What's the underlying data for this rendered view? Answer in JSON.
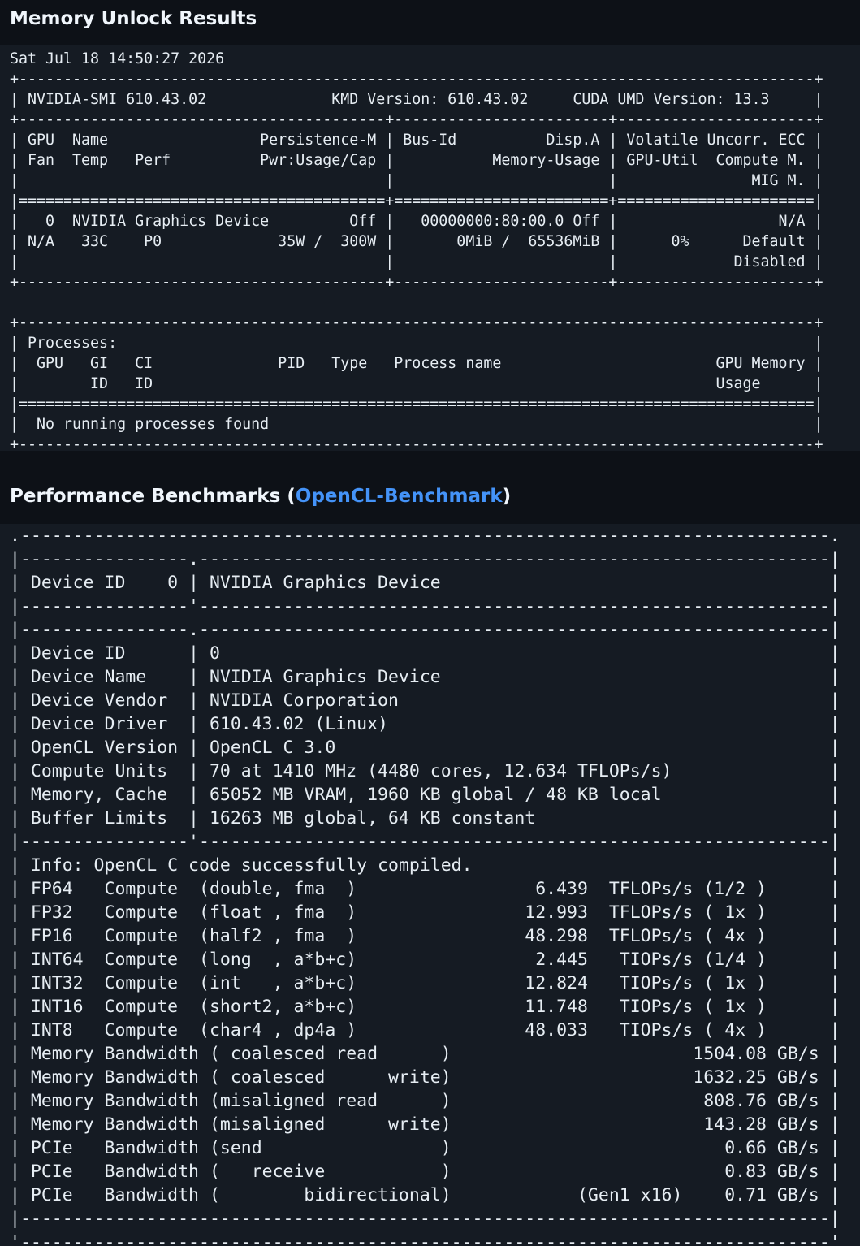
{
  "section_memory": {
    "title": "Memory Unlock Results"
  },
  "nvidia_smi": {
    "output": "Sat Jul 18 14:50:27 2026\n+-----------------------------------------------------------------------------------------+\n| NVIDIA-SMI 610.43.02              KMD Version: 610.43.02     CUDA UMD Version: 13.3     |\n+-----------------------------------------+------------------------+----------------------+\n| GPU  Name                 Persistence-M | Bus-Id          Disp.A | Volatile Uncorr. ECC |\n| Fan  Temp   Perf          Pwr:Usage/Cap |           Memory-Usage | GPU-Util  Compute M. |\n|                                         |                        |               MIG M. |\n|=========================================+========================+======================|\n|   0  NVIDIA Graphics Device         Off |   00000000:80:00.0 Off |                  N/A |\n| N/A   33C    P0             35W /  300W |       0MiB /  65536MiB |      0%      Default |\n|                                         |                        |             Disabled |\n+-----------------------------------------+------------------------+----------------------+\n\n+-----------------------------------------------------------------------------------------+\n| Processes:                                                                              |\n|  GPU   GI   CI              PID   Type   Process name                        GPU Memory |\n|        ID   ID                                                               Usage      |\n|=========================================================================================|\n|  No running processes found                                                             |\n+-----------------------------------------------------------------------------------------+"
  },
  "section_bench": {
    "title_prefix": "Performance Benchmarks (",
    "link_label": "OpenCL-Benchmark",
    "title_suffix": ")"
  },
  "opencl_benchmark": {
    "output": ".-----------------------------------------------------------------------------.\n|----------------.------------------------------------------------------------|\n| Device ID    0 | NVIDIA Graphics Device                                     |\n|----------------'------------------------------------------------------------|\n|----------------.------------------------------------------------------------|\n| Device ID      | 0                                                          |\n| Device Name    | NVIDIA Graphics Device                                     |\n| Device Vendor  | NVIDIA Corporation                                         |\n| Device Driver  | 610.43.02 (Linux)                                          |\n| OpenCL Version | OpenCL C 3.0                                               |\n| Compute Units  | 70 at 1410 MHz (4480 cores, 12.634 TFLOPs/s)               |\n| Memory, Cache  | 65052 MB VRAM, 1960 KB global / 48 KB local                |\n| Buffer Limits  | 16263 MB global, 64 KB constant                            |\n|----------------'------------------------------------------------------------|\n| Info: OpenCL C code successfully compiled.                                  |\n| FP64   Compute  (double, fma  )                 6.439  TFLOPs/s (1/2 )      |\n| FP32   Compute  (float , fma  )                12.993  TFLOPs/s ( 1x )      |\n| FP16   Compute  (half2 , fma  )                48.298  TFLOPs/s ( 4x )      |\n| INT64  Compute  (long  , a*b+c)                 2.445   TIOPs/s (1/4 )      |\n| INT32  Compute  (int   , a*b+c)                12.824   TIOPs/s ( 1x )      |\n| INT16  Compute  (short2, a*b+c)                11.748   TIOPs/s ( 1x )      |\n| INT8   Compute  (char4 , dp4a )                48.033   TIOPs/s ( 4x )      |\n| Memory Bandwidth ( coalesced read      )                       1504.08 GB/s |\n| Memory Bandwidth ( coalesced      write)                       1632.25 GB/s |\n| Memory Bandwidth (misaligned read      )                        808.76 GB/s |\n| Memory Bandwidth (misaligned      write)                        143.28 GB/s |\n| PCIe   Bandwidth (send                 )                          0.66 GB/s |\n| PCIe   Bandwidth (   receive           )                          0.83 GB/s |\n| PCIe   Bandwidth (        bidirectional)            (Gen1 x16)    0.71 GB/s |\n|-----------------------------------------------------------------------------|\n'-----------------------------------------------------------------------------'"
  }
}
